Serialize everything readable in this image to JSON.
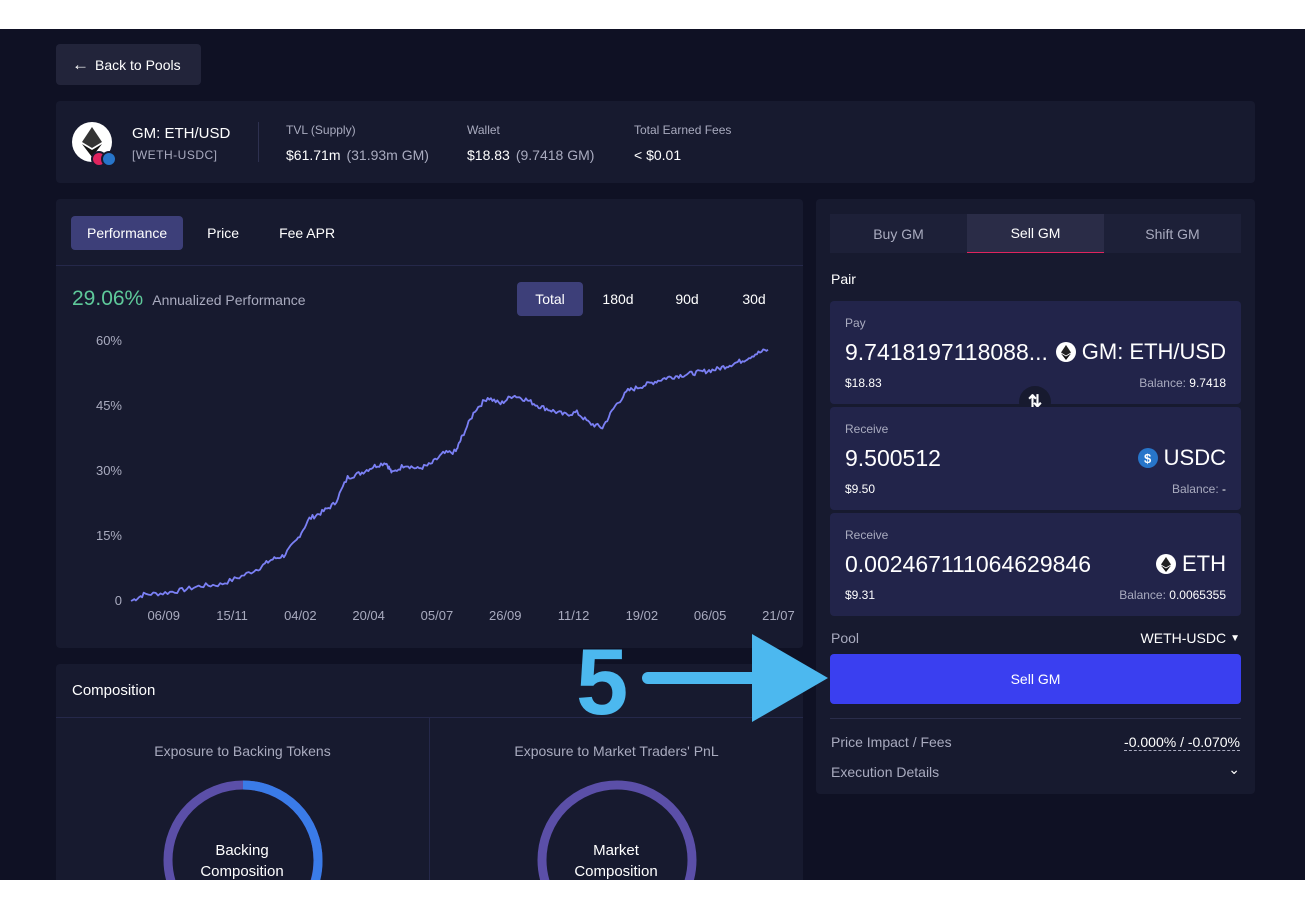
{
  "back_button": {
    "label": "Back to Pools"
  },
  "market": {
    "name": "GM: ETH/USD",
    "pair_tag": "[WETH-USDC]",
    "tvl_label": "TVL (Supply)",
    "tvl_value": "$61.71m",
    "tvl_sub": "(31.93m GM)",
    "wallet_label": "Wallet",
    "wallet_value": "$18.83",
    "wallet_sub": "(9.7418 GM)",
    "fees_label": "Total Earned Fees",
    "fees_value": "< $0.01"
  },
  "performance": {
    "tabs": [
      "Performance",
      "Price",
      "Fee APR"
    ],
    "active_tab": "Performance",
    "annualized_value": "29.06%",
    "annualized_label": "Annualized Performance",
    "ranges": [
      "Total",
      "180d",
      "90d",
      "30d"
    ],
    "active_range": "Total"
  },
  "chart_data": {
    "type": "line",
    "y_ticks": [
      "60%",
      "45%",
      "30%",
      "15%",
      "0"
    ],
    "x_ticks": [
      "06/09",
      "15/11",
      "04/02",
      "20/04",
      "05/07",
      "26/09",
      "11/12",
      "19/02",
      "06/05",
      "21/07"
    ],
    "ylim": [
      0,
      60
    ],
    "x": [
      0,
      0.02,
      0.05,
      0.08,
      0.11,
      0.14,
      0.17,
      0.2,
      0.22,
      0.24,
      0.26,
      0.28,
      0.3,
      0.32,
      0.34,
      0.36,
      0.38,
      0.4,
      0.41,
      0.43,
      0.45,
      0.47,
      0.49,
      0.51,
      0.52,
      0.54,
      0.56,
      0.58,
      0.6,
      0.62,
      0.64,
      0.66,
      0.68,
      0.7,
      0.72,
      0.74,
      0.76,
      0.78,
      0.8,
      0.82,
      0.84,
      0.86,
      0.88,
      0.9,
      0.92,
      0.94,
      0.96,
      0.98,
      1.0
    ],
    "values": [
      0,
      1.5,
      1.8,
      2.5,
      3.5,
      3.8,
      5.5,
      7.5,
      9.5,
      10.5,
      14,
      19,
      20.5,
      22.5,
      28.5,
      29.5,
      31,
      32,
      29.5,
      31.5,
      30.5,
      31.5,
      34,
      34.5,
      38,
      44,
      47,
      45.5,
      47.5,
      46.5,
      45,
      44,
      43,
      43.5,
      41,
      40,
      45,
      48.5,
      49.5,
      50.5,
      51.5,
      52,
      52.5,
      53,
      53.5,
      54.5,
      55.5,
      57,
      58
    ]
  },
  "composition": {
    "title": "Composition",
    "left_title": "Exposure to Backing Tokens",
    "left_center": [
      "Backing",
      "Composition"
    ],
    "right_title": "Exposure to Market Traders' PnL",
    "right_center": [
      "Market",
      "Composition"
    ]
  },
  "trade": {
    "tabs": [
      "Buy GM",
      "Sell GM",
      "Shift GM"
    ],
    "active_tab": "Sell GM",
    "pair_label": "Pair",
    "pay": {
      "label": "Pay",
      "amount": "9.7418197118088...",
      "token": "GM: ETH/USD",
      "usd": "$18.83",
      "balance_label": "Balance:",
      "balance": "9.7418"
    },
    "receive_1": {
      "label": "Receive",
      "amount": "9.500512",
      "token": "USDC",
      "usd": "$9.50",
      "balance_label": "Balance:",
      "balance": "-"
    },
    "receive_2": {
      "label": "Receive",
      "amount": "0.002467111064629846",
      "token": "ETH",
      "usd": "$9.31",
      "balance_label": "Balance:",
      "balance": "0.0065355"
    },
    "pool_label": "Pool",
    "pool_value": "WETH-USDC",
    "submit_label": "Sell GM",
    "price_impact_label": "Price Impact / Fees",
    "price_impact_value": "-0.000% / -0.070%",
    "execution_label": "Execution Details"
  },
  "annotation": {
    "step": "5"
  },
  "colors": {
    "background": "#0f1124",
    "card": "#171a2f",
    "accent": "#3a3ff0",
    "positive": "#5ec99a",
    "line": "#7b80f5",
    "annotation": "#4cb8ef"
  }
}
